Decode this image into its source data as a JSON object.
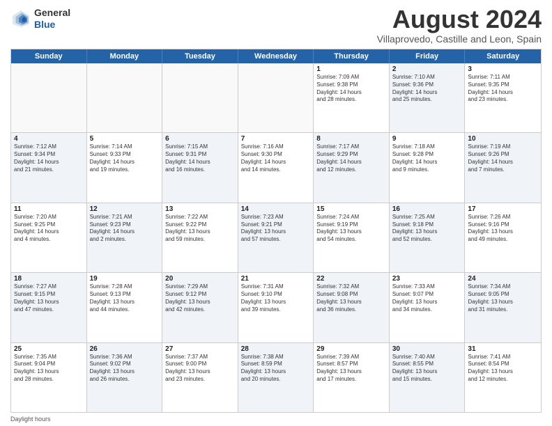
{
  "header": {
    "logo_general": "General",
    "logo_blue": "Blue",
    "title": "August 2024",
    "location": "Villaprovedo, Castille and Leon, Spain"
  },
  "weekdays": [
    "Sunday",
    "Monday",
    "Tuesday",
    "Wednesday",
    "Thursday",
    "Friday",
    "Saturday"
  ],
  "footer_label": "Daylight hours",
  "rows": [
    [
      {
        "day": "",
        "info": "",
        "empty": true
      },
      {
        "day": "",
        "info": "",
        "empty": true
      },
      {
        "day": "",
        "info": "",
        "empty": true
      },
      {
        "day": "",
        "info": "",
        "empty": true
      },
      {
        "day": "1",
        "info": "Sunrise: 7:09 AM\nSunset: 9:38 PM\nDaylight: 14 hours\nand 28 minutes.",
        "empty": false,
        "alt": false
      },
      {
        "day": "2",
        "info": "Sunrise: 7:10 AM\nSunset: 9:36 PM\nDaylight: 14 hours\nand 25 minutes.",
        "empty": false,
        "alt": true
      },
      {
        "day": "3",
        "info": "Sunrise: 7:11 AM\nSunset: 9:35 PM\nDaylight: 14 hours\nand 23 minutes.",
        "empty": false,
        "alt": false
      }
    ],
    [
      {
        "day": "4",
        "info": "Sunrise: 7:12 AM\nSunset: 9:34 PM\nDaylight: 14 hours\nand 21 minutes.",
        "empty": false,
        "alt": true
      },
      {
        "day": "5",
        "info": "Sunrise: 7:14 AM\nSunset: 9:33 PM\nDaylight: 14 hours\nand 19 minutes.",
        "empty": false,
        "alt": false
      },
      {
        "day": "6",
        "info": "Sunrise: 7:15 AM\nSunset: 9:31 PM\nDaylight: 14 hours\nand 16 minutes.",
        "empty": false,
        "alt": true
      },
      {
        "day": "7",
        "info": "Sunrise: 7:16 AM\nSunset: 9:30 PM\nDaylight: 14 hours\nand 14 minutes.",
        "empty": false,
        "alt": false
      },
      {
        "day": "8",
        "info": "Sunrise: 7:17 AM\nSunset: 9:29 PM\nDaylight: 14 hours\nand 12 minutes.",
        "empty": false,
        "alt": true
      },
      {
        "day": "9",
        "info": "Sunrise: 7:18 AM\nSunset: 9:28 PM\nDaylight: 14 hours\nand 9 minutes.",
        "empty": false,
        "alt": false
      },
      {
        "day": "10",
        "info": "Sunrise: 7:19 AM\nSunset: 9:26 PM\nDaylight: 14 hours\nand 7 minutes.",
        "empty": false,
        "alt": true
      }
    ],
    [
      {
        "day": "11",
        "info": "Sunrise: 7:20 AM\nSunset: 9:25 PM\nDaylight: 14 hours\nand 4 minutes.",
        "empty": false,
        "alt": false
      },
      {
        "day": "12",
        "info": "Sunrise: 7:21 AM\nSunset: 9:23 PM\nDaylight: 14 hours\nand 2 minutes.",
        "empty": false,
        "alt": true
      },
      {
        "day": "13",
        "info": "Sunrise: 7:22 AM\nSunset: 9:22 PM\nDaylight: 13 hours\nand 59 minutes.",
        "empty": false,
        "alt": false
      },
      {
        "day": "14",
        "info": "Sunrise: 7:23 AM\nSunset: 9:21 PM\nDaylight: 13 hours\nand 57 minutes.",
        "empty": false,
        "alt": true
      },
      {
        "day": "15",
        "info": "Sunrise: 7:24 AM\nSunset: 9:19 PM\nDaylight: 13 hours\nand 54 minutes.",
        "empty": false,
        "alt": false
      },
      {
        "day": "16",
        "info": "Sunrise: 7:25 AM\nSunset: 9:18 PM\nDaylight: 13 hours\nand 52 minutes.",
        "empty": false,
        "alt": true
      },
      {
        "day": "17",
        "info": "Sunrise: 7:26 AM\nSunset: 9:16 PM\nDaylight: 13 hours\nand 49 minutes.",
        "empty": false,
        "alt": false
      }
    ],
    [
      {
        "day": "18",
        "info": "Sunrise: 7:27 AM\nSunset: 9:15 PM\nDaylight: 13 hours\nand 47 minutes.",
        "empty": false,
        "alt": true
      },
      {
        "day": "19",
        "info": "Sunrise: 7:28 AM\nSunset: 9:13 PM\nDaylight: 13 hours\nand 44 minutes.",
        "empty": false,
        "alt": false
      },
      {
        "day": "20",
        "info": "Sunrise: 7:29 AM\nSunset: 9:12 PM\nDaylight: 13 hours\nand 42 minutes.",
        "empty": false,
        "alt": true
      },
      {
        "day": "21",
        "info": "Sunrise: 7:31 AM\nSunset: 9:10 PM\nDaylight: 13 hours\nand 39 minutes.",
        "empty": false,
        "alt": false
      },
      {
        "day": "22",
        "info": "Sunrise: 7:32 AM\nSunset: 9:08 PM\nDaylight: 13 hours\nand 36 minutes.",
        "empty": false,
        "alt": true
      },
      {
        "day": "23",
        "info": "Sunrise: 7:33 AM\nSunset: 9:07 PM\nDaylight: 13 hours\nand 34 minutes.",
        "empty": false,
        "alt": false
      },
      {
        "day": "24",
        "info": "Sunrise: 7:34 AM\nSunset: 9:05 PM\nDaylight: 13 hours\nand 31 minutes.",
        "empty": false,
        "alt": true
      }
    ],
    [
      {
        "day": "25",
        "info": "Sunrise: 7:35 AM\nSunset: 9:04 PM\nDaylight: 13 hours\nand 28 minutes.",
        "empty": false,
        "alt": false
      },
      {
        "day": "26",
        "info": "Sunrise: 7:36 AM\nSunset: 9:02 PM\nDaylight: 13 hours\nand 26 minutes.",
        "empty": false,
        "alt": true
      },
      {
        "day": "27",
        "info": "Sunrise: 7:37 AM\nSunset: 9:00 PM\nDaylight: 13 hours\nand 23 minutes.",
        "empty": false,
        "alt": false
      },
      {
        "day": "28",
        "info": "Sunrise: 7:38 AM\nSunset: 8:59 PM\nDaylight: 13 hours\nand 20 minutes.",
        "empty": false,
        "alt": true
      },
      {
        "day": "29",
        "info": "Sunrise: 7:39 AM\nSunset: 8:57 PM\nDaylight: 13 hours\nand 17 minutes.",
        "empty": false,
        "alt": false
      },
      {
        "day": "30",
        "info": "Sunrise: 7:40 AM\nSunset: 8:55 PM\nDaylight: 13 hours\nand 15 minutes.",
        "empty": false,
        "alt": true
      },
      {
        "day": "31",
        "info": "Sunrise: 7:41 AM\nSunset: 8:54 PM\nDaylight: 13 hours\nand 12 minutes.",
        "empty": false,
        "alt": false
      }
    ]
  ]
}
